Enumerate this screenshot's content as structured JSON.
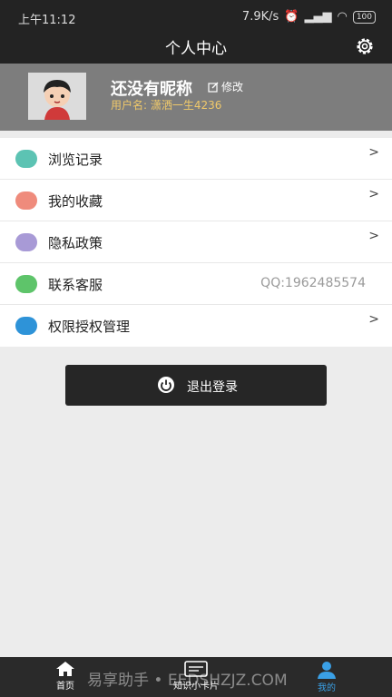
{
  "status_bar": {
    "time": "上午11:12",
    "speed": "7.9K/s",
    "battery": "100"
  },
  "header": {
    "title": "个人中心",
    "settings_icon": "gear-icon"
  },
  "profile": {
    "nickname": "还没有昵称",
    "edit_label": "修改",
    "username": "用户名: 潇洒一生4236"
  },
  "menu": {
    "items": [
      {
        "label": "浏览记录",
        "icon": "history-icon",
        "color": "#5cc3b3"
      },
      {
        "label": "我的收藏",
        "icon": "star-icon",
        "color": "#ef8b7c"
      },
      {
        "label": "隐私政策",
        "icon": "info-icon",
        "color": "#a89ad6"
      },
      {
        "label": "联系客服",
        "icon": "chat-icon",
        "color": "#5ec46a",
        "value": "QQ:1962485574"
      },
      {
        "label": "权限授权管理",
        "icon": "lock-icon",
        "color": "#2e93d8"
      }
    ]
  },
  "logout": {
    "label": "退出登录"
  },
  "tabbar": {
    "items": [
      {
        "label": "首页"
      },
      {
        "label": "知识小卡片"
      },
      {
        "label": "我的"
      }
    ]
  },
  "watermark": "易享助手 • EEDSHZJZ.COM"
}
